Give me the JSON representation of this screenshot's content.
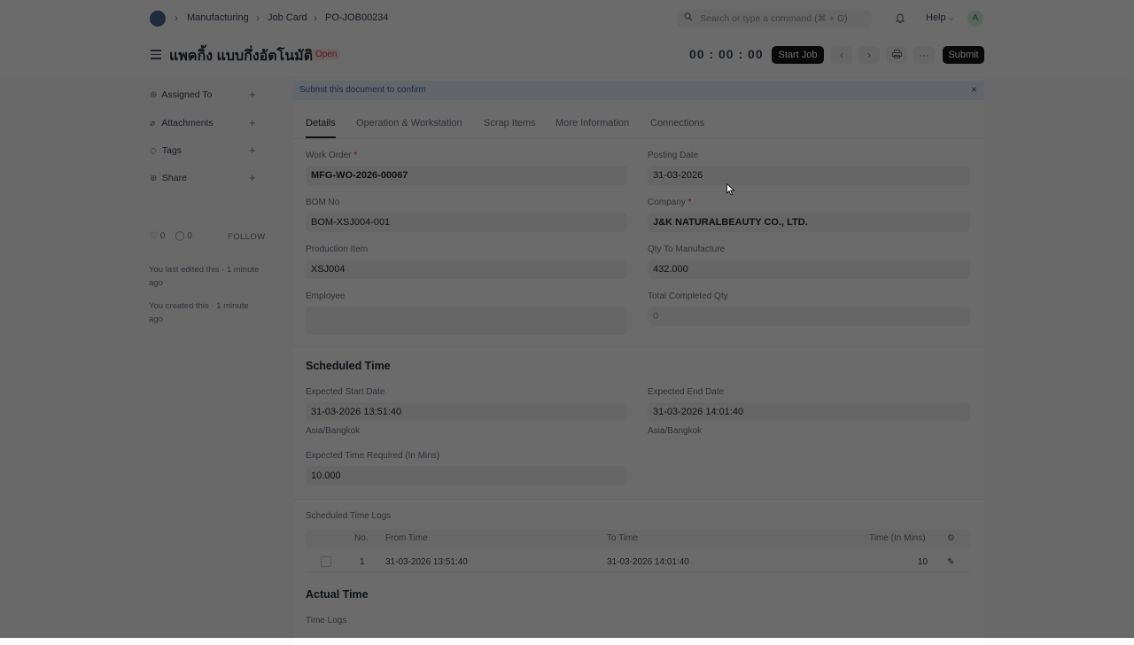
{
  "navbar": {
    "logo_letter": "",
    "breadcrumbs": [
      "Manufacturing",
      "Job Card",
      "PO-JOB00234"
    ],
    "search_placeholder": "Search or type a command (⌘ + G)",
    "help_label": "Help",
    "avatar_letter": "A"
  },
  "titlebar": {
    "title": "แพคกิ้ง แบบกึ่งอัตโนมัติ",
    "status": "Open",
    "timer": "00 : 00 : 00",
    "start_job_label": "Start Job",
    "submit_label": "Submit",
    "more_label": "···"
  },
  "sidebar": {
    "items": [
      {
        "label": "Assigned To",
        "icon": "user-circle-icon"
      },
      {
        "label": "Attachments",
        "icon": "paperclip-icon"
      },
      {
        "label": "Tags",
        "icon": "tag-icon"
      },
      {
        "label": "Share",
        "icon": "share-user-icon"
      }
    ],
    "likes": "0",
    "comments": "0",
    "follow_label": "FOLLOW",
    "activity": [
      "You last edited this · 1 minute ago",
      "You created this · 1 minute ago"
    ]
  },
  "alert": {
    "text": "Submit this document to confirm",
    "close": "×"
  },
  "tabs": [
    "Details",
    "Operation & Workstation",
    "Scrap Items",
    "More Information",
    "Connections"
  ],
  "details": {
    "work_order": {
      "label": "Work Order",
      "value": "MFG-WO-2026-00067"
    },
    "posting_date": {
      "label": "Posting Date",
      "value": "31-03-2026"
    },
    "bom_no": {
      "label": "BOM No",
      "value": "BOM-XSJ004-001"
    },
    "company": {
      "label": "Company",
      "value": "J&K NATURALBEAUTY CO., LTD."
    },
    "production_item": {
      "label": "Production Item",
      "value": "XSJ004"
    },
    "qty_to_manufacture": {
      "label": "Qty To Manufacture",
      "value": "432.000"
    },
    "employee": {
      "label": "Employee",
      "value": ""
    },
    "total_completed_qty": {
      "label": "Total Completed Qty",
      "value": "0"
    }
  },
  "scheduled": {
    "heading": "Scheduled Time",
    "start": {
      "label": "Expected Start Date",
      "value": "31-03-2026 13:51:40",
      "tz": "Asia/Bangkok"
    },
    "end": {
      "label": "Expected End Date",
      "value": "31-03-2026 14:01:40",
      "tz": "Asia/Bangkok"
    },
    "time_required": {
      "label": "Expected Time Required (In Mins)",
      "value": "10.000"
    },
    "logs_label": "Scheduled Time Logs",
    "columns": [
      "No.",
      "From Time",
      "To Time",
      "Time (In Mins)"
    ],
    "rows": [
      {
        "no": "1",
        "from": "31-03-2026 13:51:40",
        "to": "31-03-2026 14:01:40",
        "mins": "10"
      }
    ]
  },
  "actual": {
    "heading": "Actual Time",
    "logs_label": "Time Logs"
  },
  "colors": {
    "overlay": "rgba(0,0,0,0.58)",
    "status_red": "#e03636",
    "primary_dark": "#171717",
    "alert_blue": "#eaf4fd"
  }
}
